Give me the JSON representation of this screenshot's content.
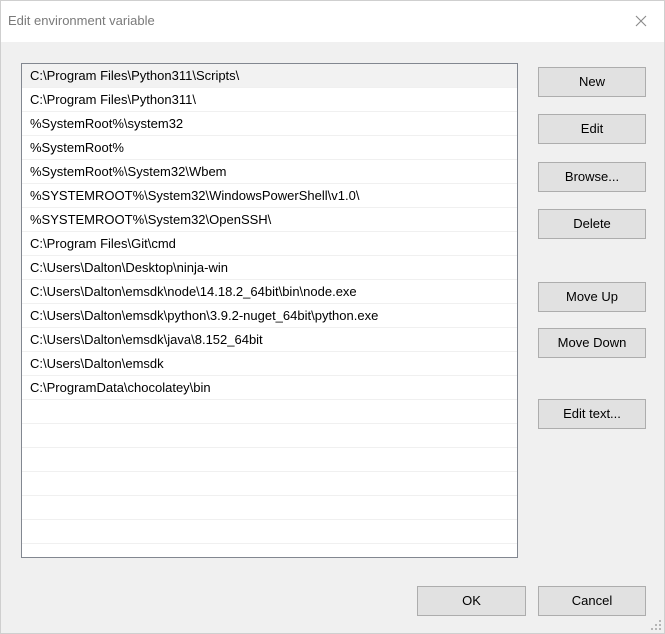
{
  "window": {
    "title": "Edit environment variable"
  },
  "paths": [
    "C:\\Program Files\\Python311\\Scripts\\",
    "C:\\Program Files\\Python311\\",
    "%SystemRoot%\\system32",
    "%SystemRoot%",
    "%SystemRoot%\\System32\\Wbem",
    "%SYSTEMROOT%\\System32\\WindowsPowerShell\\v1.0\\",
    "%SYSTEMROOT%\\System32\\OpenSSH\\",
    "C:\\Program Files\\Git\\cmd",
    "C:\\Users\\Dalton\\Desktop\\ninja-win",
    "C:\\Users\\Dalton\\emsdk\\node\\14.18.2_64bit\\bin\\node.exe",
    "C:\\Users\\Dalton\\emsdk\\python\\3.9.2-nuget_64bit\\python.exe",
    "C:\\Users\\Dalton\\emsdk\\java\\8.152_64bit",
    "C:\\Users\\Dalton\\emsdk",
    "C:\\ProgramData\\chocolatey\\bin"
  ],
  "selected_index": 0,
  "empty_rows": 6,
  "buttons": {
    "new": "New",
    "edit": "Edit",
    "browse": "Browse...",
    "delete": "Delete",
    "move_up": "Move Up",
    "move_down": "Move Down",
    "edit_text": "Edit text...",
    "ok": "OK",
    "cancel": "Cancel"
  },
  "icons": {
    "close": "close-icon",
    "resize": "resize-grip-icon"
  },
  "colors": {
    "titlebar": "#ffffff",
    "dialog_bg": "#f0f0f0",
    "selected_row": "#f2f2f2",
    "button_bg": "#e1e1e1",
    "button_border": "#adadad"
  }
}
